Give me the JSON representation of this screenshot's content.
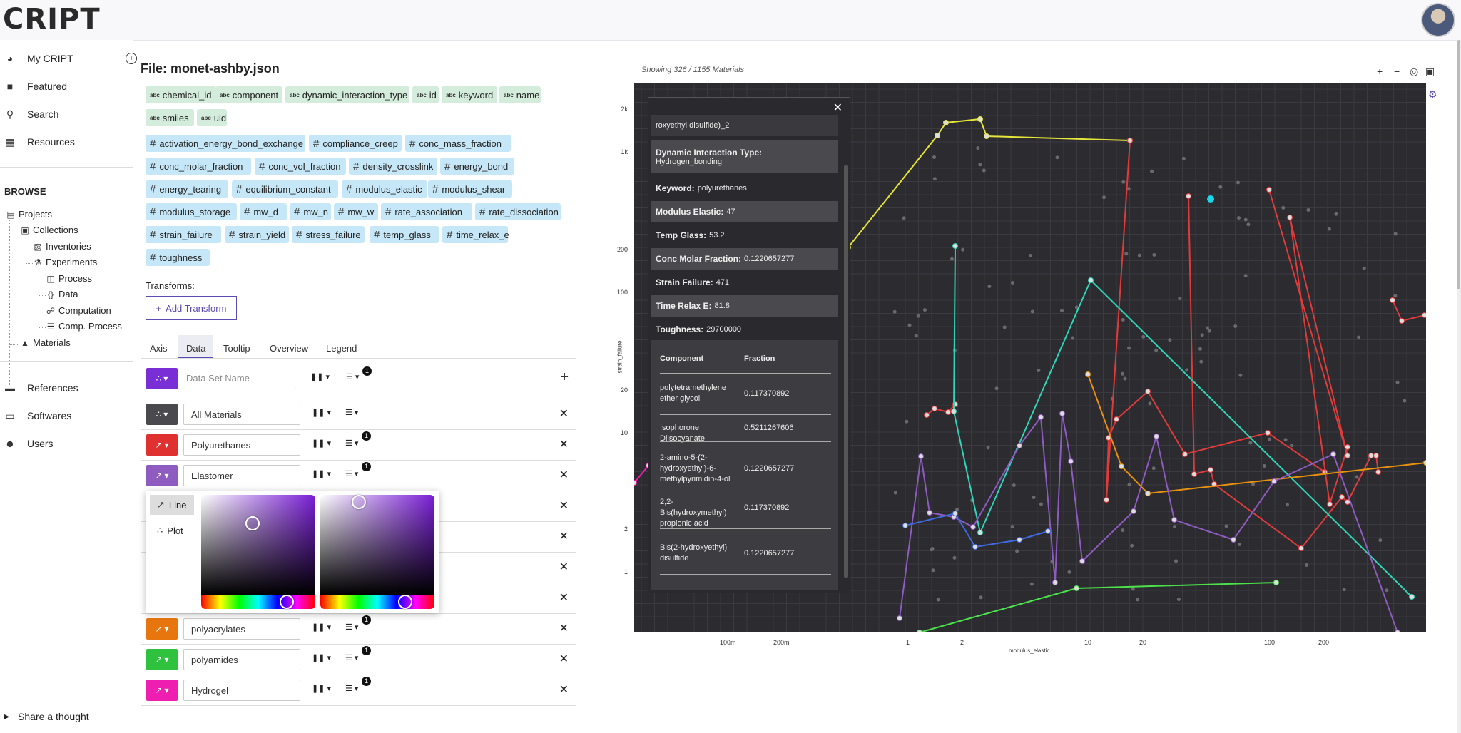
{
  "app": {
    "logo": "CRIPT"
  },
  "sidebar": {
    "nav": [
      "My CRIPT",
      "Featured",
      "Search",
      "Resources"
    ],
    "browse_label": "BROWSE",
    "tree": [
      "Projects",
      "Collections",
      "Inventories",
      "Experiments",
      "Process",
      "Data",
      "Computation",
      "Comp. Process",
      "Materials"
    ],
    "nav2": [
      "References",
      "Softwares",
      "Users"
    ],
    "share": "Share a thought"
  },
  "file": {
    "title": "File: monet-ashby.json"
  },
  "string_fields": [
    "chemical_id",
    "component",
    "dynamic_interaction_type",
    "id",
    "keyword",
    "name",
    "smiles",
    "uid"
  ],
  "number_fields": [
    "activation_energy_bond_exchange",
    "compliance_creep",
    "conc_mass_fraction",
    "conc_molar_fraction",
    "conc_vol_fraction",
    "density_crosslink",
    "energy_bond",
    "energy_tearing",
    "equilibrium_constant",
    "modulus_elastic",
    "modulus_shear",
    "modulus_storage",
    "mw_d",
    "mw_n",
    "mw_w",
    "rate_association",
    "rate_dissociation",
    "strain_failure",
    "strain_yield",
    "stress_failure",
    "temp_glass",
    "time_relax_e",
    "toughness"
  ],
  "transforms": {
    "label": "Transforms:",
    "add_button": "Add Transform"
  },
  "tabs": [
    "Axis",
    "Data",
    "Tooltip",
    "Overview",
    "Legend"
  ],
  "new_dataset": {
    "placeholder": "Data Set Name",
    "badge": "1"
  },
  "datasets": [
    {
      "name": "All Materials",
      "color": "#4a4a4e",
      "badge": ""
    },
    {
      "name": "Polyurethanes",
      "color": "#e03131",
      "badge": "1"
    },
    {
      "name": "Elastomer",
      "color": "#8e5bc0",
      "badge": "1"
    },
    {
      "name": "",
      "color": "",
      "badge": ""
    },
    {
      "name": "",
      "color": "",
      "badge": ""
    },
    {
      "name": "",
      "color": "",
      "badge": ""
    },
    {
      "name": "",
      "color": "",
      "badge": ""
    },
    {
      "name": "polyacrylates",
      "color": "#e8760f",
      "badge": "1"
    },
    {
      "name": "polyamides",
      "color": "#2fc23f",
      "badge": "1"
    },
    {
      "name": "Hydrogel",
      "color": "#ee1fb0",
      "badge": "1"
    }
  ],
  "picker": {
    "options": [
      "Line",
      "Plot"
    ]
  },
  "chart": {
    "showing": "Showing 326 / 1155 Materials",
    "xlabel": "modulus_elastic",
    "ylabel": "strain_failure",
    "yticks": [
      "2k",
      "1k",
      "200",
      "100",
      "20",
      "10",
      "2",
      "1"
    ],
    "xticks": [
      "100m",
      "200m",
      "1",
      "2",
      "10",
      "20",
      "100",
      "200"
    ]
  },
  "tooltip": {
    "header": "roxyethyl disulfide)_2",
    "dit_label": "Dynamic Interaction Type:",
    "dit_value": "Hydrogen_bonding",
    "rows": [
      {
        "label": "Keyword:",
        "value": "polyurethanes"
      },
      {
        "label": "Modulus Elastic:",
        "value": "47"
      },
      {
        "label": "Temp Glass:",
        "value": "53.2"
      },
      {
        "label": "Conc Molar Fraction:",
        "value": "0.1220657277"
      },
      {
        "label": "Strain Failure:",
        "value": "471"
      },
      {
        "label": "Time Relax E:",
        "value": "81.8"
      },
      {
        "label": "Toughness:",
        "value": "29700000"
      }
    ],
    "table_headers": [
      "Component",
      "Fraction"
    ],
    "table": [
      {
        "component": "polytetramethylene ether glycol",
        "fraction": "0.117370892"
      },
      {
        "component": "Isophorone Diisocyanate",
        "fraction": "0.5211267606"
      },
      {
        "component": "2-amino-5-(2-hydroxyethyl)-6-methylpyrimidin-4-ol",
        "fraction": "0.1220657277"
      },
      {
        "component": "2,2-Bis(hydroxymethyl) propionic acid",
        "fraction": "0.117370892"
      },
      {
        "component": "Bis(2-hydroxyethyl) disulfide",
        "fraction": "0.1220657277"
      }
    ]
  }
}
